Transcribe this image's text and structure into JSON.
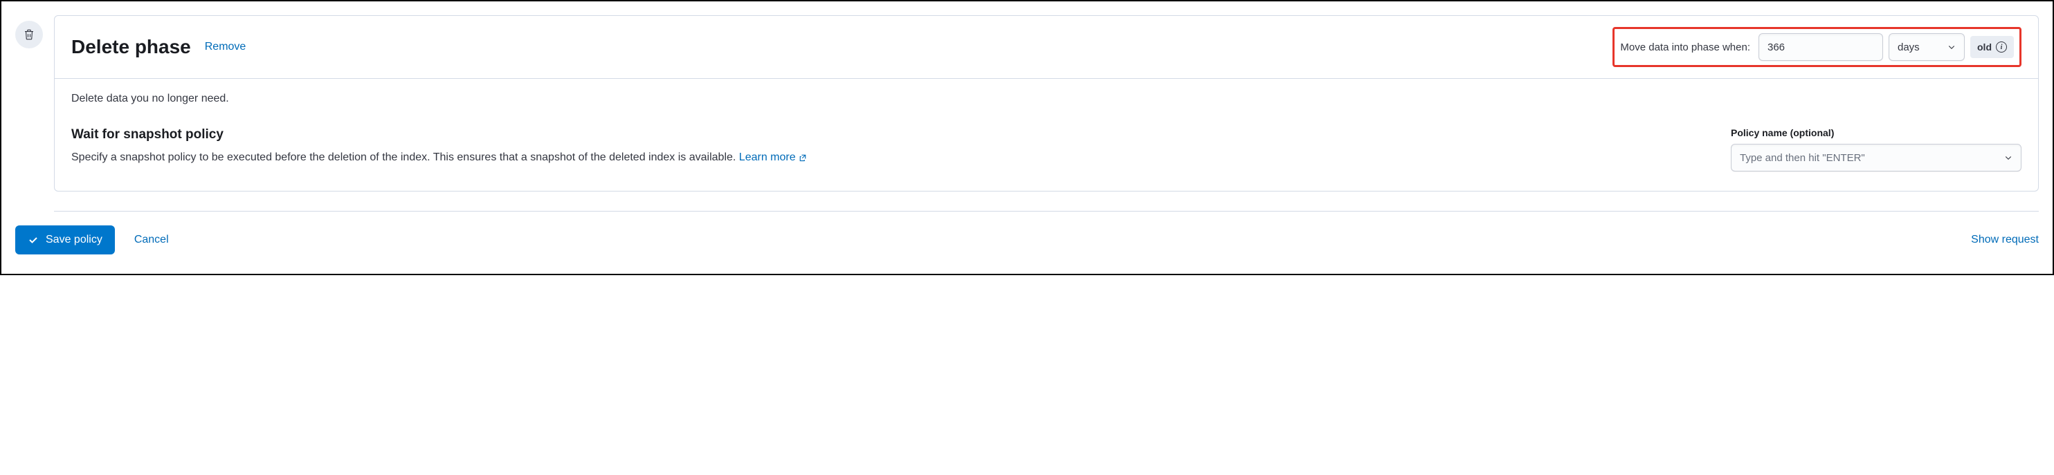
{
  "phase": {
    "title": "Delete phase",
    "remove_label": "Remove",
    "move_label": "Move data into phase when:",
    "age_value": "366",
    "unit_label": "days",
    "old_label": "old",
    "description": "Delete data you no longer need."
  },
  "snapshot": {
    "title": "Wait for snapshot policy",
    "description": "Specify a snapshot policy to be executed before the deletion of the index. This ensures that a snapshot of the deleted index is available.",
    "learn_more": "Learn more",
    "field_label": "Policy name (optional)",
    "placeholder": "Type and then hit \"ENTER\""
  },
  "footer": {
    "save_label": "Save policy",
    "cancel_label": "Cancel",
    "show_request_label": "Show request"
  }
}
